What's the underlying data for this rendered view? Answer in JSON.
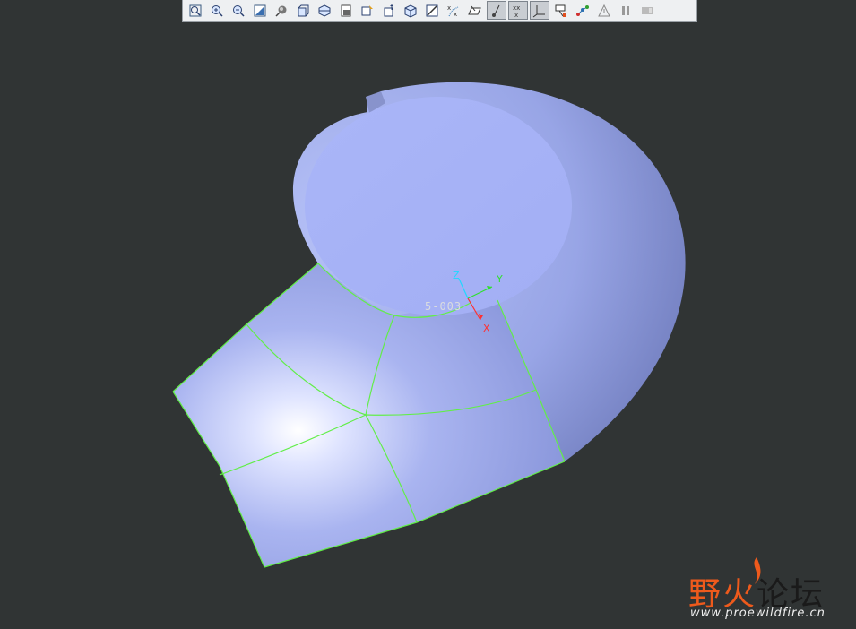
{
  "toolbar": {
    "buttons": [
      {
        "name": "refit-icon",
        "active": false
      },
      {
        "name": "zoom-in-icon",
        "active": false
      },
      {
        "name": "zoom-out-icon",
        "active": false
      },
      {
        "name": "repaint-icon",
        "active": false
      },
      {
        "name": "shade-mode-icon",
        "active": false
      },
      {
        "name": "view-box-icon",
        "active": false
      },
      {
        "name": "saved-views-icon",
        "active": false
      },
      {
        "name": "view-manager-icon",
        "active": false
      },
      {
        "name": "layers-icon",
        "active": false
      },
      {
        "name": "orient-icon",
        "active": false
      },
      {
        "name": "cube-view-icon",
        "active": false
      },
      {
        "name": "section-icon",
        "active": false
      },
      {
        "name": "datum-points-icon",
        "active": false
      },
      {
        "name": "datum-planes-icon",
        "active": false
      },
      {
        "name": "datum-axes-icon",
        "active": true
      },
      {
        "name": "point-display-icon",
        "active": true
      },
      {
        "name": "csys-display-icon",
        "active": true
      },
      {
        "name": "annotation-icon",
        "active": false
      },
      {
        "name": "spin-center-icon",
        "active": false
      },
      {
        "name": "warning-icon",
        "active": false
      },
      {
        "name": "pause-icon",
        "active": false
      },
      {
        "name": "disabled-icon",
        "active": false
      }
    ]
  },
  "model": {
    "csys_label": "5-003",
    "axes": {
      "x": "X",
      "y": "Y",
      "z": "Z"
    },
    "surface_color": "#a6b2f2",
    "edge_color": "#62ee48"
  },
  "watermark": {
    "title_left": "野火",
    "title_right": "论坛",
    "url": "www.proewildfire.cn",
    "accent_color": "#ee5a1c"
  }
}
